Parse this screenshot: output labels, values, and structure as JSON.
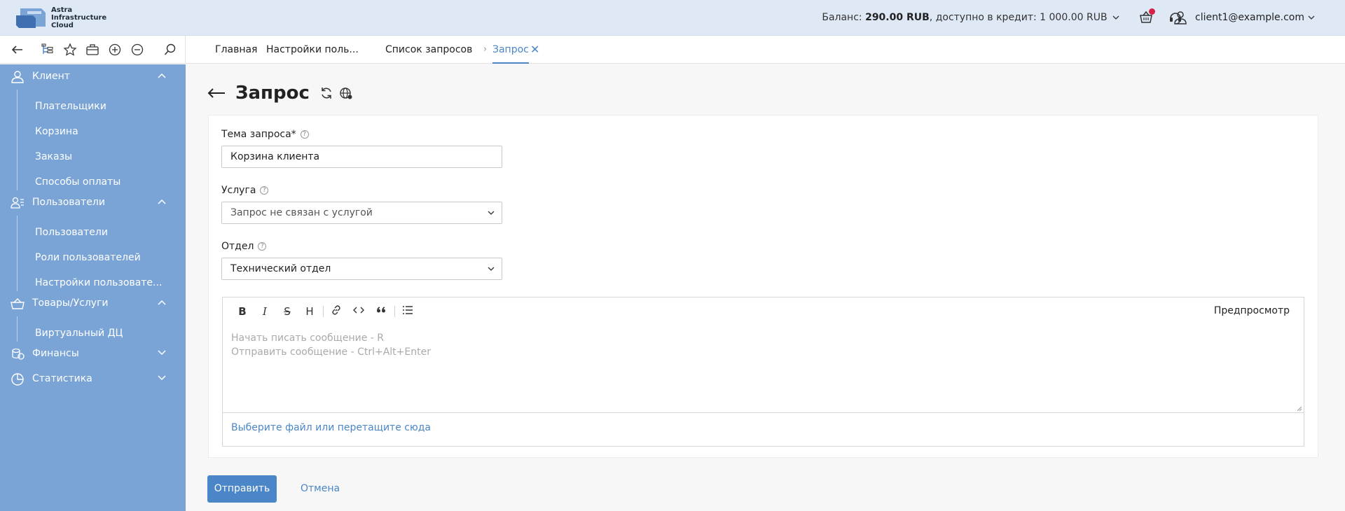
{
  "header": {
    "logo_text": [
      "Astra",
      "Infrastructure",
      "Cloud"
    ],
    "balance_label": "Баланс:",
    "balance_value": "290.00 RUB",
    "credit_label": ",  доступно в кредит:",
    "credit_value": "1 000.00 RUB",
    "user_email": "client1@example.com",
    "icons": [
      "cart-icon",
      "support-icon",
      "user-icon"
    ]
  },
  "tabs": [
    {
      "label": "Главная"
    },
    {
      "label": "Настройки поль..."
    },
    {
      "label": "Список запросов"
    },
    {
      "label": "Запрос",
      "active": true
    }
  ],
  "toolbar_icons": [
    "back-icon",
    "tree-icon",
    "star-icon",
    "briefcase-icon",
    "zoom-in-icon",
    "zoom-out-icon",
    "search-icon"
  ],
  "sidebar": {
    "groups": [
      {
        "label": "Клиент",
        "icon": "client-icon",
        "expanded": true,
        "items": [
          "Плательщики",
          "Корзина",
          "Заказы",
          "Способы оплаты"
        ]
      },
      {
        "label": "Пользователи",
        "icon": "users-icon",
        "expanded": true,
        "items": [
          "Пользователи",
          "Роли пользователей",
          "Настройки пользовате..."
        ]
      },
      {
        "label": "Товары/Услуги",
        "icon": "basket-icon",
        "expanded": true,
        "items": [
          "Виртуальный ДЦ"
        ]
      },
      {
        "label": "Финансы",
        "icon": "coins-icon",
        "expanded": false,
        "items": []
      },
      {
        "label": "Статистика",
        "icon": "chart-pie-icon",
        "expanded": false,
        "items": []
      }
    ]
  },
  "page": {
    "title": "Запрос",
    "form": {
      "subject_label": "Тема запроса*",
      "subject_value": "Корзина клиента",
      "service_label": "Услуга",
      "service_value": "Запрос не связан с услугой",
      "department_label": "Отдел",
      "department_value": "Технический отдел"
    },
    "editor": {
      "tools": [
        "B",
        "I",
        "S",
        "H",
        "link",
        "code",
        "quote",
        "list"
      ],
      "preview_label": "Предпросмотр",
      "placeholder_line1": "Начать писать сообщение - R",
      "placeholder_line2": "Отправить сообщение - Ctrl+Alt+Enter",
      "file_label": "Выберите файл или перетащите сюда"
    },
    "submit_label": "Отправить",
    "cancel_label": "Отмена"
  },
  "colors": {
    "accent": "#4a86c8",
    "sidebar": "#7aa4d6",
    "header": "#dfe9f6",
    "notification": "#d62246"
  }
}
